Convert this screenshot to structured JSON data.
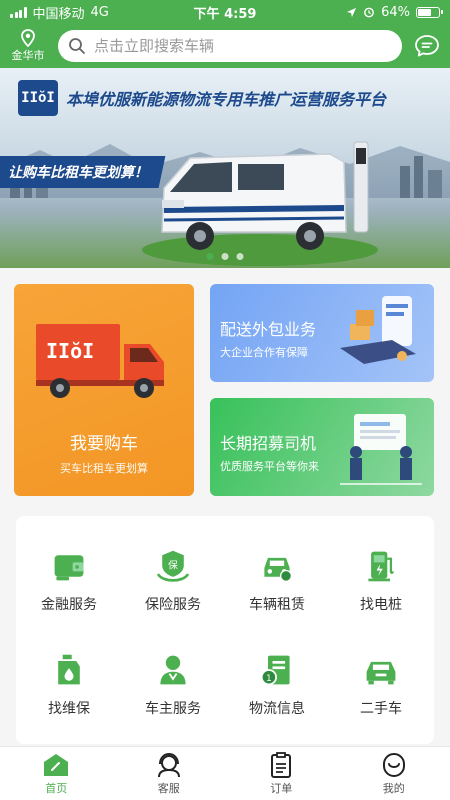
{
  "status_bar": {
    "carrier": "中国移动",
    "network": "4G",
    "time": "下午 4:59",
    "battery": "64%",
    "battery_level": 0.64
  },
  "header": {
    "city": "金华市",
    "search_placeholder": "点击立即搜索车辆"
  },
  "banner": {
    "logo_text": "IIŏI",
    "title": "本埠优服新能源物流专用车推广运营服务平台",
    "slogan": "让购车比租车更划算！",
    "slides": 3,
    "active_slide": 1
  },
  "cards": {
    "buy": {
      "title": "我要购车",
      "subtitle": "买车比租车更划算"
    },
    "delivery": {
      "title": "配送外包业务",
      "subtitle": "大企业合作有保障"
    },
    "drivers": {
      "title": "长期招募司机",
      "subtitle": "优质服务平台等你来"
    }
  },
  "services": [
    {
      "label": "金融服务",
      "icon": "wallet-icon"
    },
    {
      "label": "保险服务",
      "icon": "insurance-icon"
    },
    {
      "label": "车辆租赁",
      "icon": "car-rental-icon"
    },
    {
      "label": "找电桩",
      "icon": "charging-pile-icon"
    },
    {
      "label": "找维保",
      "icon": "maintenance-icon"
    },
    {
      "label": "车主服务",
      "icon": "owner-service-icon"
    },
    {
      "label": "物流信息",
      "icon": "logistics-info-icon"
    },
    {
      "label": "二手车",
      "icon": "used-car-icon"
    }
  ],
  "tabs": [
    {
      "label": "首页",
      "icon": "home-icon",
      "active": true
    },
    {
      "label": "客服",
      "icon": "customer-service-icon",
      "active": false
    },
    {
      "label": "订单",
      "icon": "order-icon",
      "active": false
    },
    {
      "label": "我的",
      "icon": "profile-icon",
      "active": false
    }
  ],
  "colors": {
    "primary": "#4CAF50",
    "orange": "#F39625",
    "blue": "#74A4F4",
    "green": "#38C15A"
  }
}
